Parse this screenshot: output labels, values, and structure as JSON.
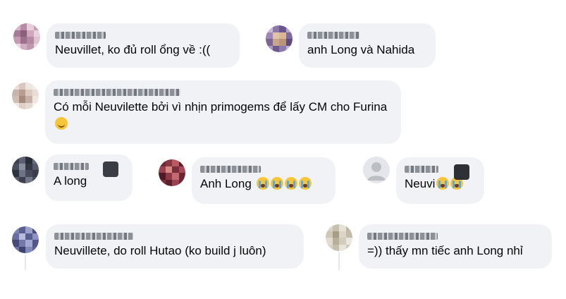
{
  "comments": [
    {
      "id": "c1",
      "text": "Neuvillet, ko đủ roll ổng về :((",
      "emojis": []
    },
    {
      "id": "c2",
      "text": "anh Long và Nahida",
      "emojis": []
    },
    {
      "id": "c3",
      "text": "Có mỗi Neuvilette bởi vì nhịn primogems để lấy CM cho Furina",
      "emojis": [
        "smile"
      ]
    },
    {
      "id": "c4",
      "text": "A long",
      "emojis": []
    },
    {
      "id": "c5",
      "text": "Anh Long",
      "emojis": [
        "cry",
        "cry",
        "cry",
        "cry"
      ]
    },
    {
      "id": "c6",
      "text": "Neuvi",
      "emojis": [
        "cry",
        "cry"
      ]
    },
    {
      "id": "c7",
      "text": "Neuvillete, do roll Hutao (ko build j luôn)",
      "emojis": []
    },
    {
      "id": "c8",
      "text": "=)) thấy mn tiếc anh Long nhỉ",
      "emojis": []
    }
  ],
  "icons": {
    "emoji_smile": "slightly-smiling-face-icon",
    "emoji_cry": "loudly-crying-face-icon",
    "badge": "fan-badge-icon"
  },
  "colors": {
    "bubble": "#f0f2f5",
    "text": "#050505",
    "thread_line": "#e4e6eb"
  }
}
